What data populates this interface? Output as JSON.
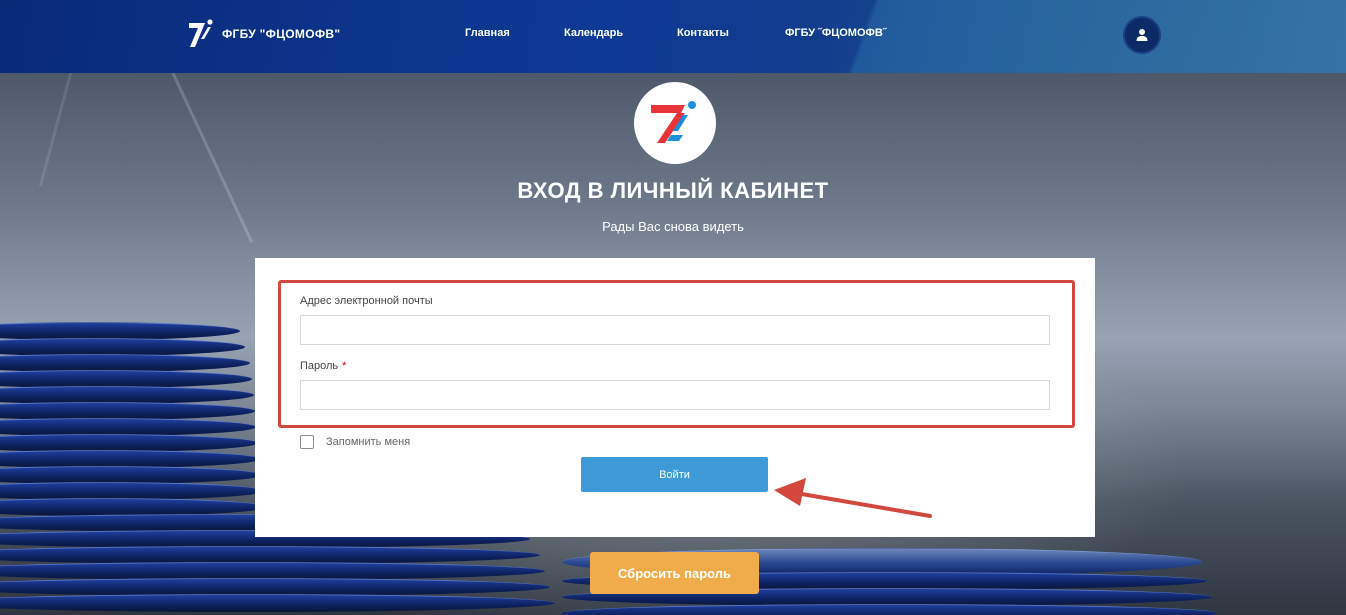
{
  "brand": {
    "name": "ФГБУ \"ФЦОМОФВ\"",
    "icon": "seven-logo-icon"
  },
  "nav": {
    "items": [
      {
        "label": "Главная"
      },
      {
        "label": "Календарь"
      },
      {
        "label": "Контакты"
      },
      {
        "label": "ФГБУ ˝ФЦОМОФВ˝"
      }
    ],
    "user_icon": "user-icon"
  },
  "login": {
    "title": "ВХОД В ЛИЧНЫЙ КАБИНЕТ",
    "subtitle": "Рады Вас снова видеть",
    "email_label": "Адрес электронной почты",
    "email_value": "",
    "password_label": "Пароль",
    "password_required": "*",
    "password_value": "",
    "remember_label": "Запомнить меня",
    "submit_label": "Войти",
    "reset_label": "Сбросить пароль"
  },
  "colors": {
    "nav_bg": "#0d3a96",
    "primary_button": "#3e9bd8",
    "reset_button": "#f0ab4a",
    "highlight": "#d2483f",
    "logo_red": "#e8333b",
    "logo_blue": "#1b8fd9"
  }
}
